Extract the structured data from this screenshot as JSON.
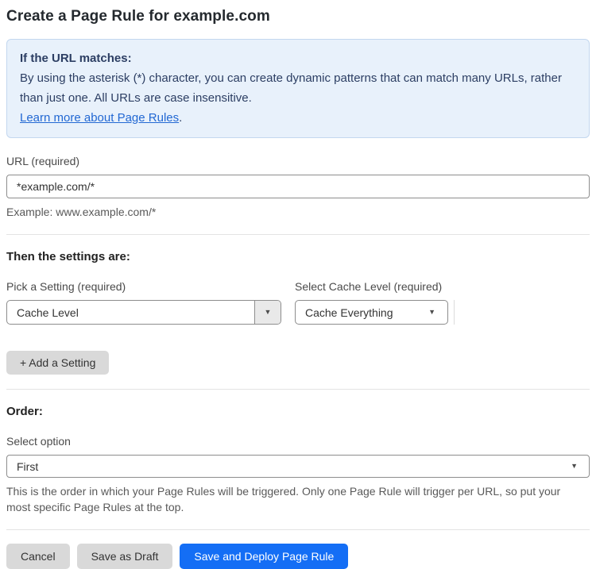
{
  "page": {
    "title": "Create a Page Rule for example.com"
  },
  "info_box": {
    "heading": "If the URL matches:",
    "body": "By using the asterisk (*) character, you can create dynamic patterns that can match many URLs, rather than just one. All URLs are case insensitive.",
    "link_label": "Learn more about Page Rules",
    "link_suffix": "."
  },
  "url_field": {
    "label": "URL (required)",
    "value": "*example.com/*",
    "helper": "Example: www.example.com/*"
  },
  "settings": {
    "heading": "Then the settings are:",
    "setting_picker": {
      "label": "Pick a Setting (required)",
      "value": "Cache Level"
    },
    "cache_level_picker": {
      "label": "Select Cache Level (required)",
      "value": "Cache Everything"
    },
    "add_setting_label": "+ Add a Setting"
  },
  "order": {
    "heading": "Order:",
    "label": "Select option",
    "value": "First",
    "helper": "This is the order in which your Page Rules will be triggered. Only one Page Rule will trigger per URL, so put your most specific Page Rules at the top."
  },
  "actions": {
    "cancel_label": "Cancel",
    "save_draft_label": "Save as Draft",
    "save_deploy_label": "Save and Deploy Page Rule"
  },
  "icons": {
    "dropdown_caret": "▼"
  },
  "colors": {
    "info_bg": "#e8f1fb",
    "info_border": "#c3d7ef",
    "info_text": "#2c3e63",
    "link": "#2268d3",
    "primary_button": "#146ef5",
    "secondary_button": "#d9d9d9",
    "input_border": "#8d8d8d"
  }
}
